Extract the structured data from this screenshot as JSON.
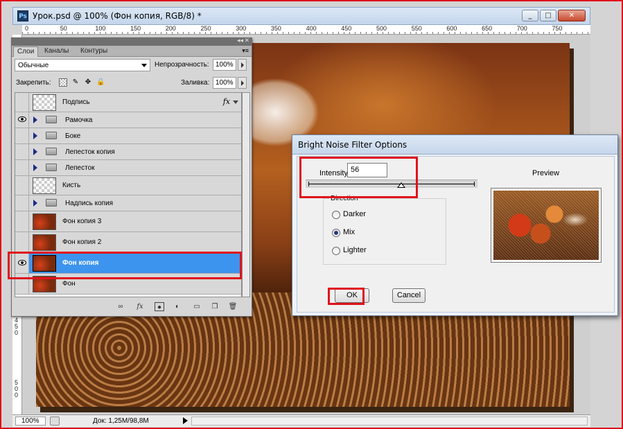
{
  "window": {
    "title": "Урок.psd @ 100% (Фон  копия, RGB/8) *",
    "app_icon": "Ps",
    "buttons": [
      "_",
      "□",
      "✕"
    ]
  },
  "rulers": {
    "horizontal": [
      "0",
      "50",
      "100",
      "150",
      "200",
      "250",
      "300",
      "350",
      "400",
      "450",
      "500",
      "550",
      "600",
      "650",
      "700",
      "750"
    ],
    "vertical": [
      "450",
      "500"
    ]
  },
  "layers_panel": {
    "tabs": [
      "Слои",
      "Каналы",
      "Контуры"
    ],
    "blend_mode": "Обычные",
    "opacity_label": "Непрозрачность:",
    "opacity_value": "100%",
    "lock_label": "Закрепить:",
    "fill_label": "Заливка:",
    "fill_value": "100%",
    "layers": [
      {
        "name": "Подпись",
        "kind": "text",
        "visible": false,
        "fx": "fx"
      },
      {
        "name": "Рамочка",
        "kind": "group",
        "visible": true
      },
      {
        "name": "Боке",
        "kind": "group",
        "visible": false
      },
      {
        "name": "Лепесток копия",
        "kind": "group",
        "visible": false
      },
      {
        "name": "Лепесток",
        "kind": "group",
        "visible": false
      },
      {
        "name": "Кисть",
        "kind": "empty",
        "visible": false
      },
      {
        "name": "Надпись копия",
        "kind": "group",
        "visible": false
      },
      {
        "name": "Фон  копия 3",
        "kind": "image",
        "visible": false
      },
      {
        "name": "Фон  копия 2",
        "kind": "image",
        "visible": false
      },
      {
        "name": "Фон  копия",
        "kind": "image",
        "visible": true,
        "selected": true
      },
      {
        "name": "Фон",
        "kind": "image",
        "visible": false
      }
    ],
    "footer_icons": [
      "link-icon",
      "fx-icon",
      "mask-icon",
      "adjustment-icon",
      "group-icon",
      "new-layer-icon",
      "trash-icon"
    ],
    "footer_fx": "fx"
  },
  "dialog": {
    "title": "Bright Noise Filter Options",
    "intensity_label": "Intensity",
    "intensity_value": "56",
    "intensity_slider_fraction": 0.56,
    "direction_label": "Direction",
    "directions": [
      "Darker",
      "Mix",
      "Lighter"
    ],
    "selected_direction": "Mix",
    "preview_label": "Preview",
    "ok_label": "OK",
    "cancel_label": "Cancel"
  },
  "status": {
    "zoom": "100%",
    "doc_info": "Док: 1,25M/98,8M"
  },
  "colors": {
    "highlight": "#e0121b",
    "selection": "#3d94ee"
  }
}
